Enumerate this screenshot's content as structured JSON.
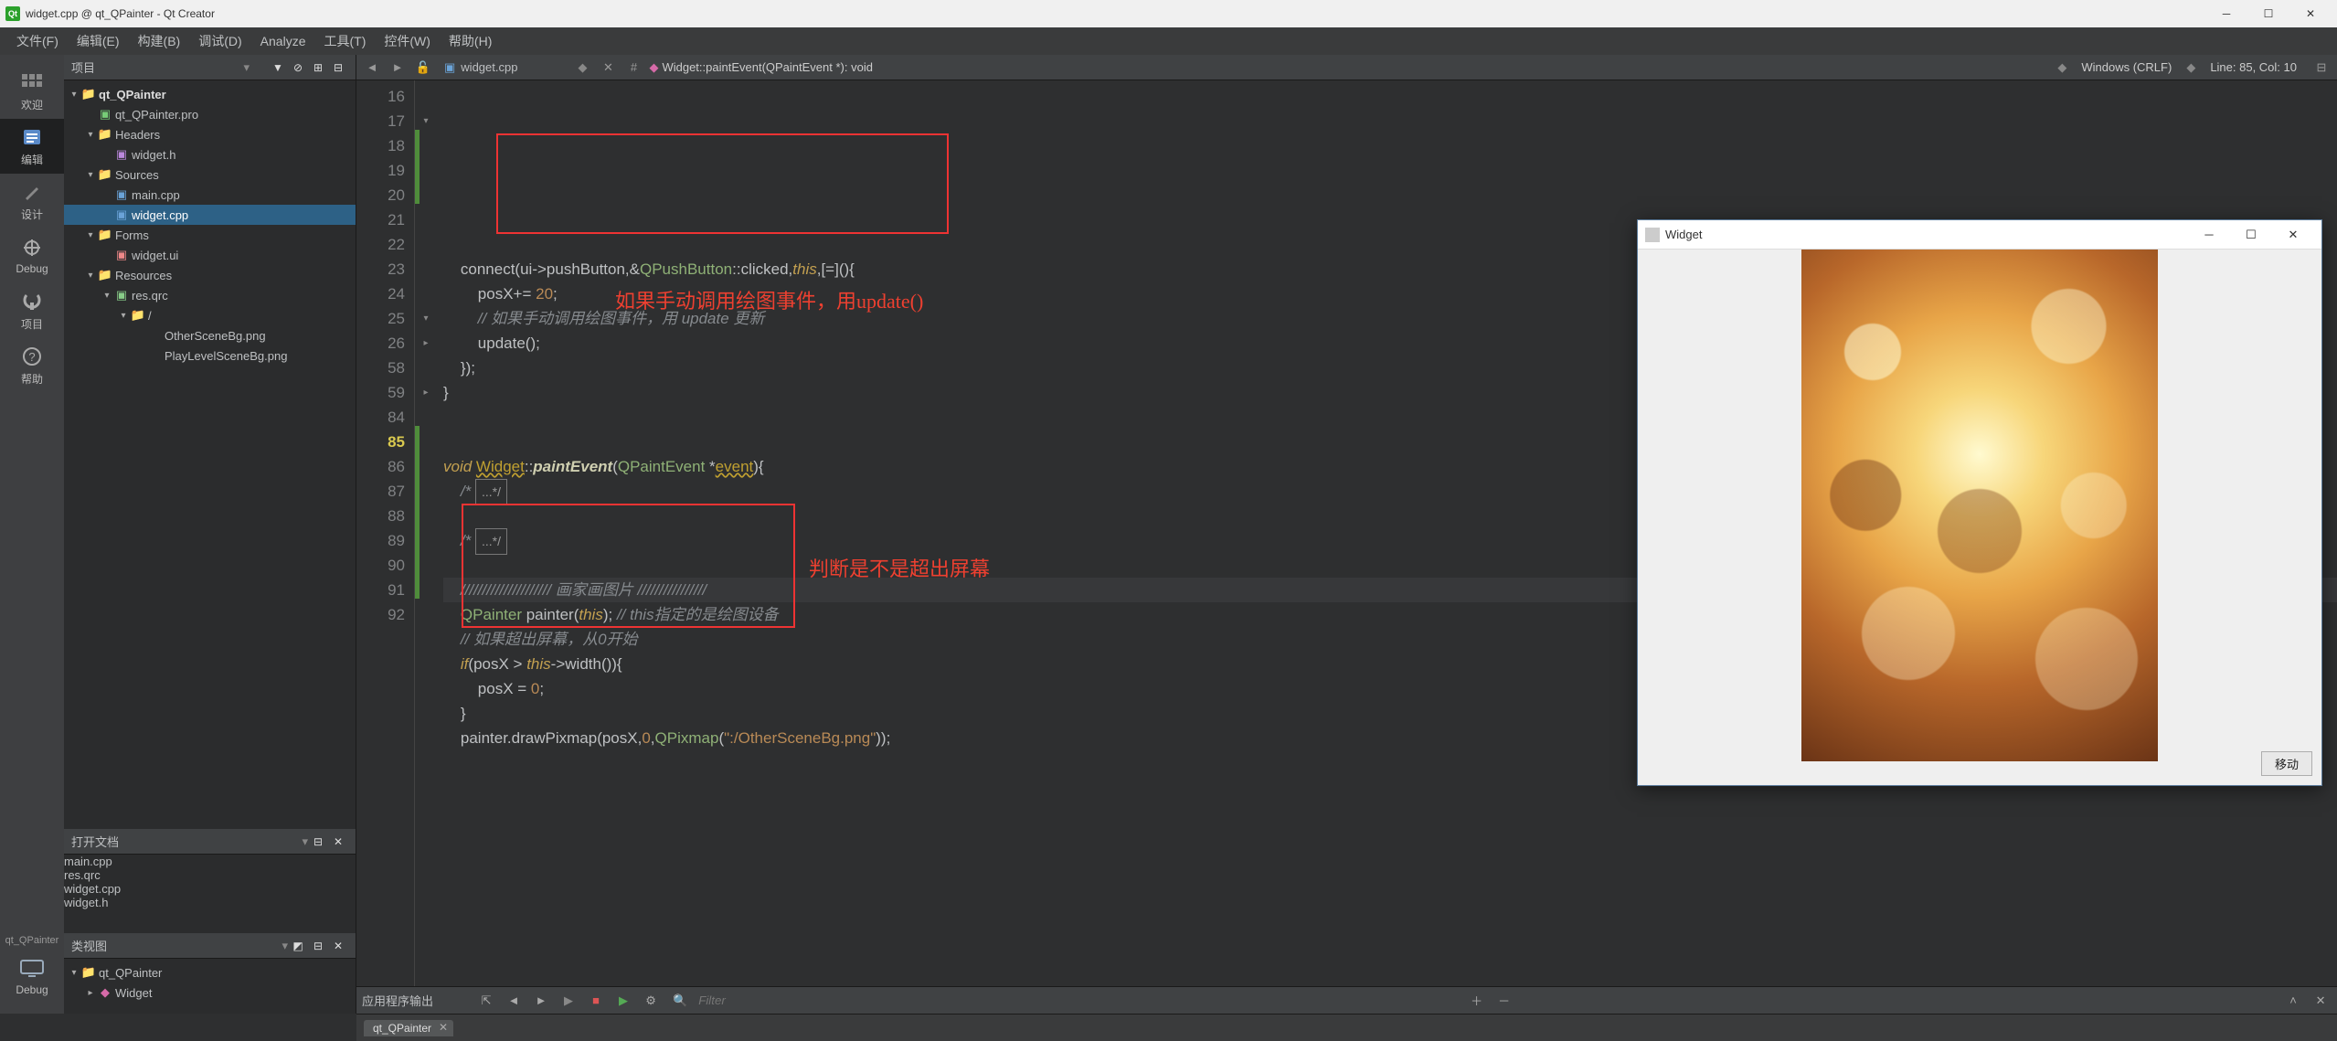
{
  "titlebar": {
    "text": "widget.cpp @ qt_QPainter - Qt Creator",
    "qt_badge": "Qt"
  },
  "menubar": [
    {
      "label": "文件(F)",
      "key": "F"
    },
    {
      "label": "编辑(E)",
      "key": "E"
    },
    {
      "label": "构建(B)",
      "key": "B"
    },
    {
      "label": "调试(D)",
      "key": "D"
    },
    {
      "label": "Analyze",
      "key": ""
    },
    {
      "label": "工具(T)",
      "key": "T"
    },
    {
      "label": "控件(W)",
      "key": "W"
    },
    {
      "label": "帮助(H)",
      "key": "H"
    }
  ],
  "modes": [
    {
      "id": "welcome",
      "label": "欢迎"
    },
    {
      "id": "edit",
      "label": "编辑",
      "active": true
    },
    {
      "id": "design",
      "label": "设计"
    },
    {
      "id": "debug",
      "label": "Debug"
    },
    {
      "id": "projects",
      "label": "项目"
    },
    {
      "id": "help",
      "label": "帮助"
    }
  ],
  "bottom_mode": {
    "label": "Debug",
    "project": "qt_QPainter"
  },
  "project_panel": {
    "title": "项目",
    "tree": [
      {
        "ind": 0,
        "chev": "▾",
        "icon": "folder-q",
        "label": "qt_QPainter",
        "bold": true
      },
      {
        "ind": 1,
        "chev": "",
        "icon": "pro",
        "label": "qt_QPainter.pro"
      },
      {
        "ind": 1,
        "chev": "▾",
        "icon": "folder-h",
        "label": "Headers"
      },
      {
        "ind": 2,
        "chev": "",
        "icon": "h",
        "label": "widget.h"
      },
      {
        "ind": 1,
        "chev": "▾",
        "icon": "folder-c",
        "label": "Sources"
      },
      {
        "ind": 2,
        "chev": "",
        "icon": "cpp",
        "label": "main.cpp"
      },
      {
        "ind": 2,
        "chev": "",
        "icon": "cpp",
        "label": "widget.cpp",
        "sel": true
      },
      {
        "ind": 1,
        "chev": "▾",
        "icon": "folder",
        "label": "Forms"
      },
      {
        "ind": 2,
        "chev": "",
        "icon": "ui",
        "label": "widget.ui"
      },
      {
        "ind": 1,
        "chev": "▾",
        "icon": "folder-r",
        "label": "Resources"
      },
      {
        "ind": 2,
        "chev": "▾",
        "icon": "qrc",
        "label": "res.qrc"
      },
      {
        "ind": 3,
        "chev": "▾",
        "icon": "folder",
        "label": "/"
      },
      {
        "ind": 4,
        "chev": "",
        "icon": "",
        "label": "OtherSceneBg.png"
      },
      {
        "ind": 4,
        "chev": "",
        "icon": "",
        "label": "PlayLevelSceneBg.png"
      }
    ]
  },
  "open_docs": {
    "title": "打开文档",
    "items": [
      "main.cpp",
      "res.qrc",
      "widget.cpp",
      "widget.h"
    ],
    "selected": "widget.cpp"
  },
  "class_view": {
    "title": "类视图",
    "items": [
      {
        "ind": 0,
        "chev": "▾",
        "icon": "folder",
        "label": "qt_QPainter"
      },
      {
        "ind": 1,
        "chev": "▸",
        "icon": "class",
        "label": "Widget"
      }
    ]
  },
  "editor_nav": {
    "file": "widget.cpp",
    "breadcrumb_symbol": "Widget::paintEvent(QPaintEvent *): void",
    "line_ending": "Windows (CRLF)",
    "cursor": "Line: 85, Col: 10"
  },
  "code": {
    "lines": [
      {
        "n": 16,
        "fold": "",
        "chg": "",
        "html": ""
      },
      {
        "n": 17,
        "fold": "▾",
        "chg": "",
        "html": "    connect(ui-&gt;pushButton,&amp;<span class='tok-type'>QPushButton</span>::clicked,<span class='tok-this'>this</span>,[=](){"
      },
      {
        "n": 18,
        "fold": "",
        "chg": "g",
        "html": "        posX+= <span class='tok-num'>20</span>;"
      },
      {
        "n": 19,
        "fold": "",
        "chg": "g",
        "html": "        <span class='tok-cmt'>// 如果手动调用绘图事件，用 update 更新</span>"
      },
      {
        "n": 20,
        "fold": "",
        "chg": "g",
        "html": "        update();"
      },
      {
        "n": 21,
        "fold": "",
        "chg": "",
        "html": "    });"
      },
      {
        "n": 22,
        "fold": "",
        "chg": "",
        "html": "}"
      },
      {
        "n": 23,
        "fold": "",
        "chg": "",
        "html": ""
      },
      {
        "n": 24,
        "fold": "",
        "chg": "",
        "html": ""
      },
      {
        "n": 25,
        "fold": "▾",
        "chg": "",
        "html": "<span class='tok-kw'>void</span> <span class='tok-warn'>Widget</span>::<span class='tok-func'>paintEvent</span>(<span class='tok-type'>QPaintEvent</span> *<span class='tok-warn'>event</span>){"
      },
      {
        "n": 26,
        "fold": "▸",
        "chg": "",
        "html": "    <span class='tok-cmt'>/* <span class='fold-box'>...*/</span></span>"
      },
      {
        "n": 58,
        "fold": "",
        "chg": "",
        "html": ""
      },
      {
        "n": 59,
        "fold": "▸",
        "chg": "",
        "html": "    <span class='tok-cmt'>/* <span class='fold-box'>...*/</span></span>"
      },
      {
        "n": 84,
        "fold": "",
        "chg": "",
        "html": ""
      },
      {
        "n": 85,
        "fold": "",
        "chg": "g",
        "cur": true,
        "html": "    <span class='tok-cmt'>///////////////////// 画家画图片 ////////////////</span>"
      },
      {
        "n": 86,
        "fold": "",
        "chg": "g",
        "html": "    <span class='tok-type'>QPainter</span> painter(<span class='tok-this'>this</span>); <span class='tok-cmt'>// this指定的是绘图设备</span>"
      },
      {
        "n": 87,
        "fold": "",
        "chg": "g",
        "html": "    <span class='tok-cmt'>// 如果超出屏幕，从0开始</span>"
      },
      {
        "n": 88,
        "fold": "",
        "chg": "g",
        "html": "    <span class='tok-kw'>if</span>(posX &gt; <span class='tok-this'>this</span>-&gt;width()){"
      },
      {
        "n": 89,
        "fold": "",
        "chg": "g",
        "html": "        posX = <span class='tok-num'>0</span>;"
      },
      {
        "n": 90,
        "fold": "",
        "chg": "g",
        "html": "    }"
      },
      {
        "n": 91,
        "fold": "",
        "chg": "g",
        "html": "    painter.drawPixmap(posX,<span class='tok-num'>0</span>,<span class='tok-type'>QPixmap</span>(<span class='tok-str'>\":/OtherSceneBg.png\"</span>));"
      },
      {
        "n": 92,
        "fold": "",
        "chg": "",
        "html": ""
      }
    ]
  },
  "annotations": {
    "note1": "如果手动调用绘图事件，用update()",
    "note2": "判断是不是超出屏幕"
  },
  "output_bar": {
    "title": "应用程序输出",
    "filter_placeholder": "Filter"
  },
  "bottom_tab": "qt_QPainter",
  "widget_window": {
    "title": "Widget",
    "button": "移动"
  }
}
